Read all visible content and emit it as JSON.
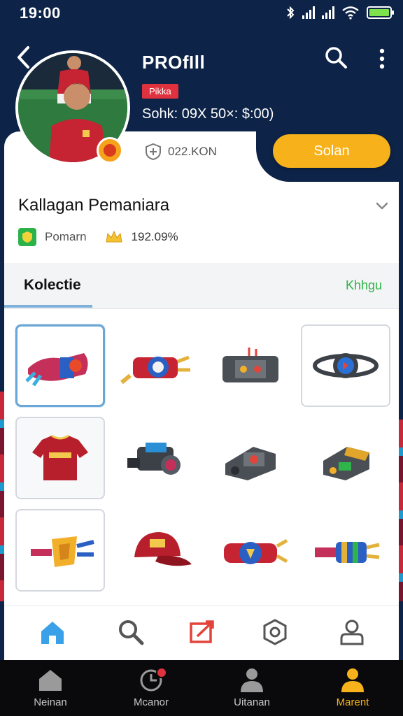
{
  "status_bar": {
    "time": "19:00",
    "battery_level": 1.0
  },
  "header": {
    "title": "PROfIll",
    "tag": "Pikka",
    "stats": "Sohk: 09X 50×: $:00)"
  },
  "profile": {
    "power_value": "022.KON",
    "action_label": "Solan",
    "section_title": "Kallagan Pemaniara",
    "meta_label": "Pomarn",
    "meta_value": "192.09%"
  },
  "tabs": {
    "active": "Kolectie",
    "link": "Khhgu"
  },
  "items": [
    {
      "name": "glove-item",
      "kind": "glove",
      "state": "selected"
    },
    {
      "name": "bracer-item",
      "kind": "bracer",
      "state": "plain"
    },
    {
      "name": "gear-case-item",
      "kind": "case",
      "state": "plain"
    },
    {
      "name": "ring-badge-item",
      "kind": "ring",
      "state": "framed"
    },
    {
      "name": "jersey-item",
      "kind": "jersey",
      "state": "soft"
    },
    {
      "name": "camera-item",
      "kind": "camera",
      "state": "plain"
    },
    {
      "name": "armor-module-item",
      "kind": "module",
      "state": "plain"
    },
    {
      "name": "gold-module-item",
      "kind": "gold-module",
      "state": "plain"
    },
    {
      "name": "shield-glove-item",
      "kind": "shield-glove",
      "state": "framed"
    },
    {
      "name": "cap-item",
      "kind": "cap",
      "state": "plain"
    },
    {
      "name": "emblem-bracer-item",
      "kind": "emblem-bracer",
      "state": "plain"
    },
    {
      "name": "striped-glove-item",
      "kind": "striped-glove",
      "state": "plain"
    }
  ],
  "toolbar_icons": [
    "home-icon",
    "search-icon",
    "share-icon",
    "settings-icon",
    "user-icon"
  ],
  "nav": [
    {
      "label": "Neinan",
      "icon": "home-icon"
    },
    {
      "label": "Mcanor",
      "icon": "clock-icon"
    },
    {
      "label": "Uitanan",
      "icon": "person-icon"
    },
    {
      "label": "Marent",
      "icon": "profile-icon"
    }
  ],
  "colors": {
    "accent": "#f7b21b",
    "header_bg": "#0d2347",
    "tag": "#e0313e",
    "link": "#2fb34a"
  }
}
